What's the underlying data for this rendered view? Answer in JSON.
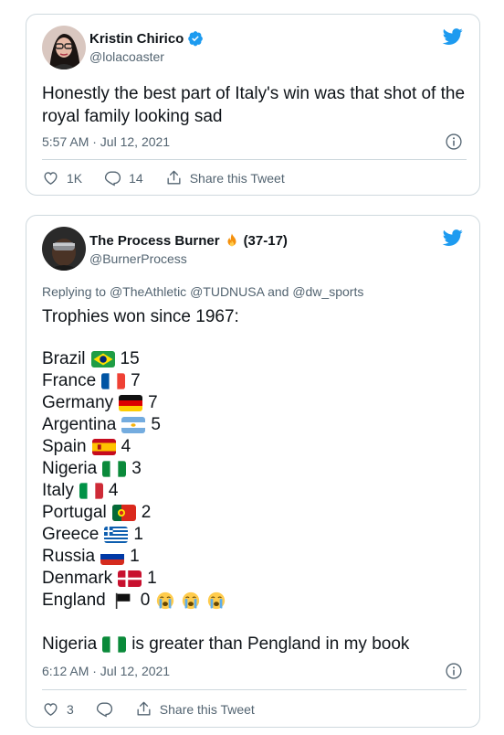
{
  "tweet1": {
    "name": "Kristin Chirico",
    "handle": "@lolacoaster",
    "text": "Honestly the best part of Italy's win was that shot of the royal family looking sad",
    "timestamp": "5:57 AM · Jul 12, 2021",
    "likes": "1K",
    "replies": "14",
    "share_label": "Share this Tweet"
  },
  "tweet2": {
    "name": "The Process Burner",
    "record": "(37-17)",
    "handle": "@BurnerProcess",
    "replying_prefix": "Replying to",
    "replying_to": "@TheAthletic @TUDNUSA and @dw_sports",
    "intro": "Trophies won since 1967:",
    "trophies": [
      {
        "country": "Brazil",
        "count": "15",
        "flag": "brazil"
      },
      {
        "country": "France",
        "count": "7",
        "flag": "france"
      },
      {
        "country": "Germany",
        "count": "7",
        "flag": "germany"
      },
      {
        "country": "Argentina",
        "count": "5",
        "flag": "argentina"
      },
      {
        "country": "Spain",
        "count": "4",
        "flag": "spain"
      },
      {
        "country": "Nigeria",
        "count": "3",
        "flag": "nigeria"
      },
      {
        "country": "Italy",
        "count": "4",
        "flag": "italy"
      },
      {
        "country": "Portugal",
        "count": "2",
        "flag": "portugal"
      },
      {
        "country": "Greece",
        "count": "1",
        "flag": "greece"
      },
      {
        "country": "Russia",
        "count": "1",
        "flag": "russia"
      },
      {
        "country": "Denmark",
        "count": "1",
        "flag": "denmark"
      },
      {
        "country": "England",
        "count": "0",
        "flag": "black-flag"
      }
    ],
    "closing_prefix": "Nigeria",
    "closing_suffix": "is greater than Pengland in my book",
    "timestamp": "6:12 AM · Jul 12, 2021",
    "likes": "3",
    "replies": "",
    "share_label": "Share this Tweet"
  },
  "colors": {
    "twitter_blue": "#1d9bf0",
    "text_secondary": "#536471",
    "border": "#cfd9de"
  }
}
